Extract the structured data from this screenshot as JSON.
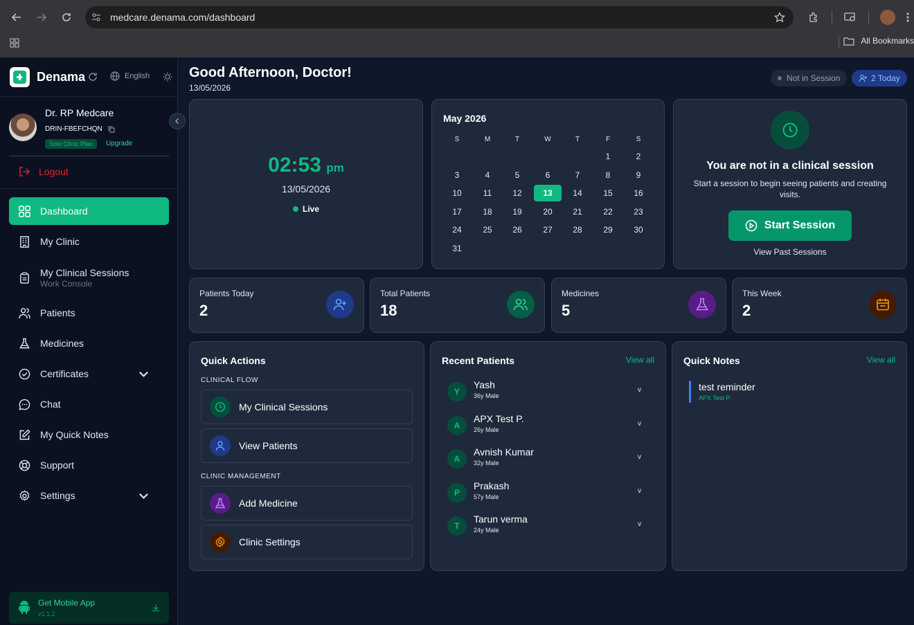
{
  "browser": {
    "url": "medcare.denama.com/dashboard",
    "bookmarks_label": "All Bookmarks"
  },
  "sidebar": {
    "brand": "Denama",
    "language": "English",
    "doctor_name": "Dr. RP Medcare",
    "doctor_id": "DRIN-FBEFCHQN",
    "plan": "Solo Clinic Plan",
    "upgrade": "Upgrade",
    "logout": "Logout",
    "items": [
      {
        "label": "Dashboard",
        "icon": "grid-icon",
        "active": true
      },
      {
        "label": "My Clinic",
        "icon": "building-icon"
      },
      {
        "label": "My Clinical Sessions",
        "sub": "Work Console",
        "icon": "clipboard-icon"
      },
      {
        "label": "Patients",
        "icon": "users-icon"
      },
      {
        "label": "Medicines",
        "icon": "flask-icon"
      },
      {
        "label": "Certificates",
        "icon": "badge-check-icon",
        "expandable": true
      },
      {
        "label": "Chat",
        "icon": "chat-icon"
      },
      {
        "label": "My Quick Notes",
        "icon": "edit-icon"
      },
      {
        "label": "Support",
        "icon": "lifebuoy-icon"
      },
      {
        "label": "Settings",
        "icon": "gear-icon",
        "expandable": true
      }
    ],
    "mobile_app": {
      "label": "Get Mobile App",
      "version": "v1.1.2"
    }
  },
  "header": {
    "greeting": "Good Afternoon, Doctor!",
    "date": "13/05/2026",
    "session_status": "Not in Session",
    "today_badge": "2 Today"
  },
  "clock": {
    "time": "02:53",
    "ampm": "pm",
    "date": "13/05/2026",
    "live": "Live"
  },
  "calendar": {
    "title": "May 2026",
    "weekdays": [
      "S",
      "M",
      "T",
      "W",
      "T",
      "F",
      "S"
    ],
    "first_weekday": 5,
    "days": 31,
    "today": 13
  },
  "session": {
    "title": "You are not in a clinical session",
    "description": "Start a session to begin seeing patients and creating visits.",
    "start_button": "Start Session",
    "past_link": "View Past Sessions"
  },
  "stats": [
    {
      "label": "Patients Today",
      "value": "2",
      "icon": "user-plus-icon",
      "color": "#3b82f6"
    },
    {
      "label": "Total Patients",
      "value": "18",
      "icon": "users-icon",
      "color": "#10b981"
    },
    {
      "label": "Medicines",
      "value": "5",
      "icon": "flask-icon",
      "color": "#a855f7"
    },
    {
      "label": "This Week",
      "value": "2",
      "icon": "calendar-icon",
      "color": "#f59e0b"
    }
  ],
  "quick_actions": {
    "title": "Quick Actions",
    "clinical_flow_label": "CLINICAL FLOW",
    "clinic_management_label": "CLINIC MANAGEMENT",
    "actions": [
      {
        "label": "My Clinical Sessions",
        "icon": "clock-icon",
        "color": "#10b981"
      },
      {
        "label": "View Patients",
        "icon": "user-icon",
        "color": "#3b82f6"
      },
      {
        "label": "Add Medicine",
        "icon": "flask-icon",
        "color": "#a855f7"
      },
      {
        "label": "Clinic Settings",
        "icon": "gear-icon",
        "color": "#f59e0b"
      }
    ]
  },
  "recent_patients": {
    "title": "Recent Patients",
    "view_all": "View all",
    "patients": [
      {
        "initial": "Y",
        "name": "Yash",
        "meta": "36y Male"
      },
      {
        "initial": "A",
        "name": "APX Test P.",
        "meta": "26y Male"
      },
      {
        "initial": "A",
        "name": "Avnish Kumar",
        "meta": "32y Male"
      },
      {
        "initial": "P",
        "name": "Prakash",
        "meta": "57y Male"
      },
      {
        "initial": "T",
        "name": "Tarun verma",
        "meta": "24y Male"
      }
    ],
    "chevron": "v"
  },
  "quick_notes": {
    "title": "Quick Notes",
    "view_all": "View all",
    "notes": [
      {
        "text": "test reminder",
        "patient": "APX Test P."
      }
    ]
  }
}
